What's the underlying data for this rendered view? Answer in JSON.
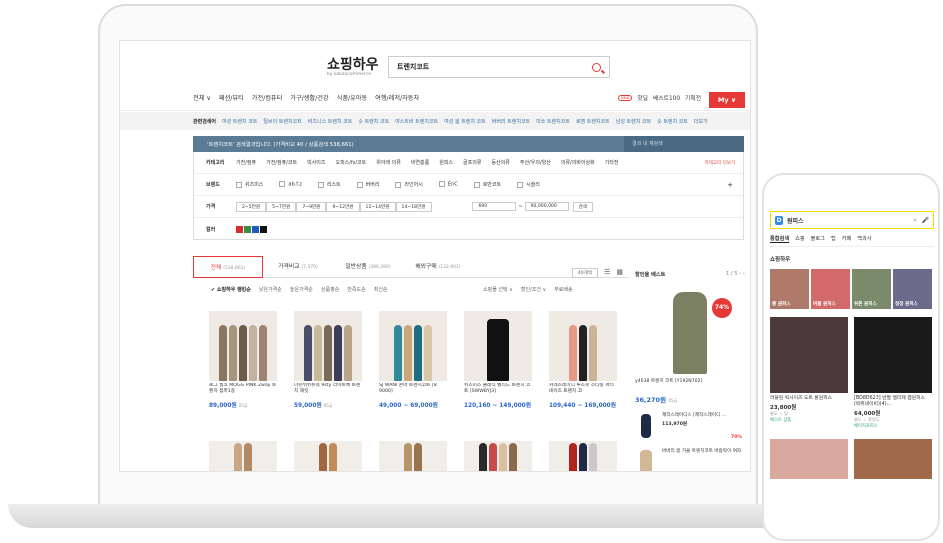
{
  "site": {
    "logo": "쇼핑하우",
    "logo_sub": "by kakaocommerce",
    "search_value": "트렌치코트",
    "gnb": [
      "전체 ∨",
      "패션/뷰티",
      "가전/컴퓨터",
      "가구/생활/건강",
      "식품/유아동",
      "여행/레저/자동차"
    ],
    "gnb_right": {
      "new": "NEW",
      "hot": "핫딜",
      "best": "베스트100",
      "event": "기획전"
    },
    "my": "My ∨",
    "related_label": "관련검색어",
    "related": [
      "여성 트렌치 코트",
      "틸브이 트렌치코트",
      "비즈니스 트렌치 코트",
      "숏 트렌치 코트",
      "여스트비 트렌치코트",
      "여성 봄 트렌치 코트",
      "버버리 트렌치코트",
      "미쏘 트렌치코트",
      "로엠 트렌치코트",
      "남성 트렌치 코트",
      "숏 트렌치 코트"
    ],
    "related_more": "더보기",
    "info": "'트렌치코트' 검색결과입니다. (가격비교 40 / 상품검색 538,661)",
    "in_search": "결과 내 재검색"
  },
  "filters": {
    "category_label": "카테고리",
    "categories": [
      "가전/컴퓨",
      "가전/컴퓨/코트",
      "빅사이즈",
      "오피스/fs/코트",
      "위아래 의류",
      "비연층룸",
      "원피스",
      "골프의류",
      "등산의류",
      "주산/우의/양산",
      "의류/의바이상화",
      "기타전"
    ],
    "category_link": "카테고리 더보기",
    "brand_label": "브랜드",
    "brands": [
      "쉬즈미스",
      "ab.f.z",
      "리스트",
      "버버리",
      "라인어시",
      "EnC",
      "로만코트",
      "시슬리"
    ],
    "price_label": "가격",
    "prices": [
      "2~5만원",
      "5~7만원",
      "7~9만원",
      "9~12만원",
      "12~14만원",
      "14~18만원"
    ],
    "price_min": "690",
    "price_max": "90,000,000",
    "price_search": "검색",
    "color_label": "컬러",
    "colors": [
      "#d32f2f",
      "#388e3c",
      "#1e5cc4",
      "#111111"
    ]
  },
  "tabs": [
    {
      "label": "전체",
      "count": "(538,661)"
    },
    {
      "label": "가격비교",
      "count": "(7,370)"
    },
    {
      "label": "일반상품",
      "count": "(386,390)"
    },
    {
      "label": "해외구매",
      "count": "(132,901)"
    }
  ],
  "sort": {
    "items": [
      "✔ 쇼핑하우 랭킹순",
      "낮은가격순",
      "높은가격순",
      "상품평순",
      "만족도순",
      "최신순"
    ],
    "right": [
      "쇼핑몰 선택 ∨",
      "할인/조건 ∨",
      "무료배송"
    ],
    "count": "40개씩"
  },
  "products": [
    {
      "name": "로그 필코 MOGG PINK 2way 트렌치 점퍼1종",
      "price": "89,000원",
      "suffix": "05급",
      "colors": [
        "#8a7561",
        "#a89580",
        "#6d5a48",
        "#c2b2a0",
        "#9b8470"
      ]
    },
    {
      "name": "나린쉬쉬뉴욕 9sty 라이트체 트렌치 재킷",
      "price": "59,000원",
      "suffix": "05급",
      "colors": [
        "#4a4e6a",
        "#c8b99c",
        "#7a6a58",
        "#3a3e58",
        "#b9a48a"
      ]
    },
    {
      "name": "SJ WANI 콘머 트렌치코트 [8 9000]",
      "price": "49,000 ~ 69,000원",
      "suffix": "",
      "colors": [
        "#2f8a9a",
        "#c9a87a",
        "#1f6d83",
        "#d9c8a8"
      ]
    },
    {
      "name": "쉬즈미스 클래식 벨티드 트렌치 코트 [SWWBYJ3]",
      "price": "120,160 ~ 149,000원",
      "suffix": "",
      "colors": [
        "#111111"
      ]
    },
    {
      "name": "커네스레이디 루즈핏 스타일 퍼터네이즈 트렌치 코",
      "price": "109,440 ~ 169,000원",
      "suffix": "",
      "colors": [
        "#e59a86",
        "#222",
        "#c9b49a"
      ]
    }
  ],
  "row2_colors": [
    [
      "#c9a688",
      "#b38a68"
    ],
    [
      "#a0683e",
      "#c48a5a"
    ],
    [
      "#b8946a",
      "#9a744e"
    ],
    [
      "#2a2a2a",
      "#c84a4a",
      "#d9c0a0",
      "#8a6a4a"
    ],
    [
      "#b0231f",
      "#1f2a44",
      "#c9c9c9"
    ]
  ],
  "side": {
    "title": "할인율 베스트",
    "pager": "1 / 5 ‹ ›",
    "discount": "74%",
    "name": "y4038 트렌치 코트 [Y192N702]",
    "price": "36,270원",
    "price_suffix": "05급",
    "items": [
      {
        "name": "제작스레이디스 [제작스레이디 ...",
        "price": "113,970원",
        "badge": "70%"
      },
      {
        "name": "버버리 봄 가을 트렌치코트 바람막이 여자",
        "price": ""
      }
    ]
  },
  "phone": {
    "search": "원피스",
    "tabs": [
      "통합검색",
      "쇼핑",
      "블로그",
      "팁",
      "카페",
      "백과사"
    ],
    "section": "쇼핑하우",
    "thumbs": [
      {
        "label": "롱 원피스",
        "color": "#b07a6a"
      },
      {
        "label": "여름 원피스",
        "color": "#d26a6a"
      },
      {
        "label": "쉬폰 원피스",
        "color": "#7a8a6a"
      },
      {
        "label": "정장 원피스",
        "color": "#6a6a8a"
      }
    ],
    "cards": [
      {
        "name": "러블린 빅사이즈 도트 롱원피스",
        "price": "23,800원",
        "meta": "쿨도 ☆ 탐",
        "link": "베스트 상품",
        "color": "#4a3a3a"
      },
      {
        "name": "[BD8D623] 반팔 엘리제 랩원피스 (빅위네이비)(4)...",
        "price": "64,000원",
        "meta": "쿨도 ☆ 흥망도",
        "link": "베이직포피스",
        "color": "#1a1a1a"
      }
    ]
  }
}
